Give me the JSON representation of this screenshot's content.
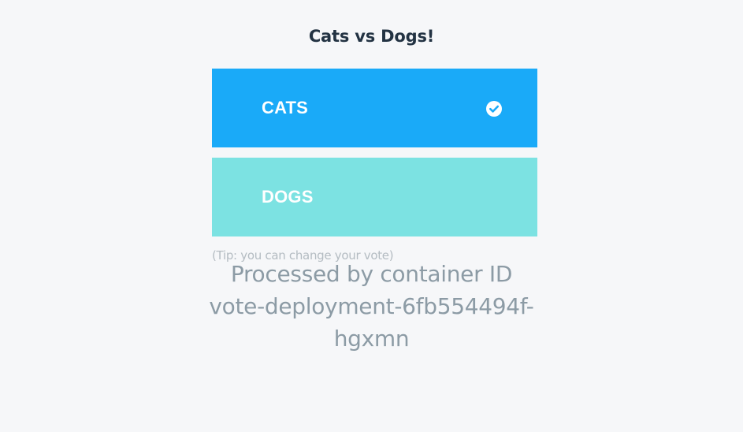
{
  "page": {
    "title": "Cats vs Dogs!"
  },
  "options": {
    "a": {
      "label": "CATS",
      "selected": true,
      "color": "#1aaaf8"
    },
    "b": {
      "label": "DOGS",
      "selected": false,
      "color": "#7ce2e2"
    }
  },
  "tip": "(Tip: you can change your vote)",
  "footer": {
    "line1": "Processed by container ID",
    "line2": "vote-deployment-6fb554494f-",
    "line3": "hgxmn"
  },
  "icons": {
    "selected": "check-circle-icon"
  },
  "colors": {
    "background": "#f6f7f9",
    "title": "#233343",
    "tip": "#b4bcc2",
    "footer": "#8c9ba5"
  }
}
